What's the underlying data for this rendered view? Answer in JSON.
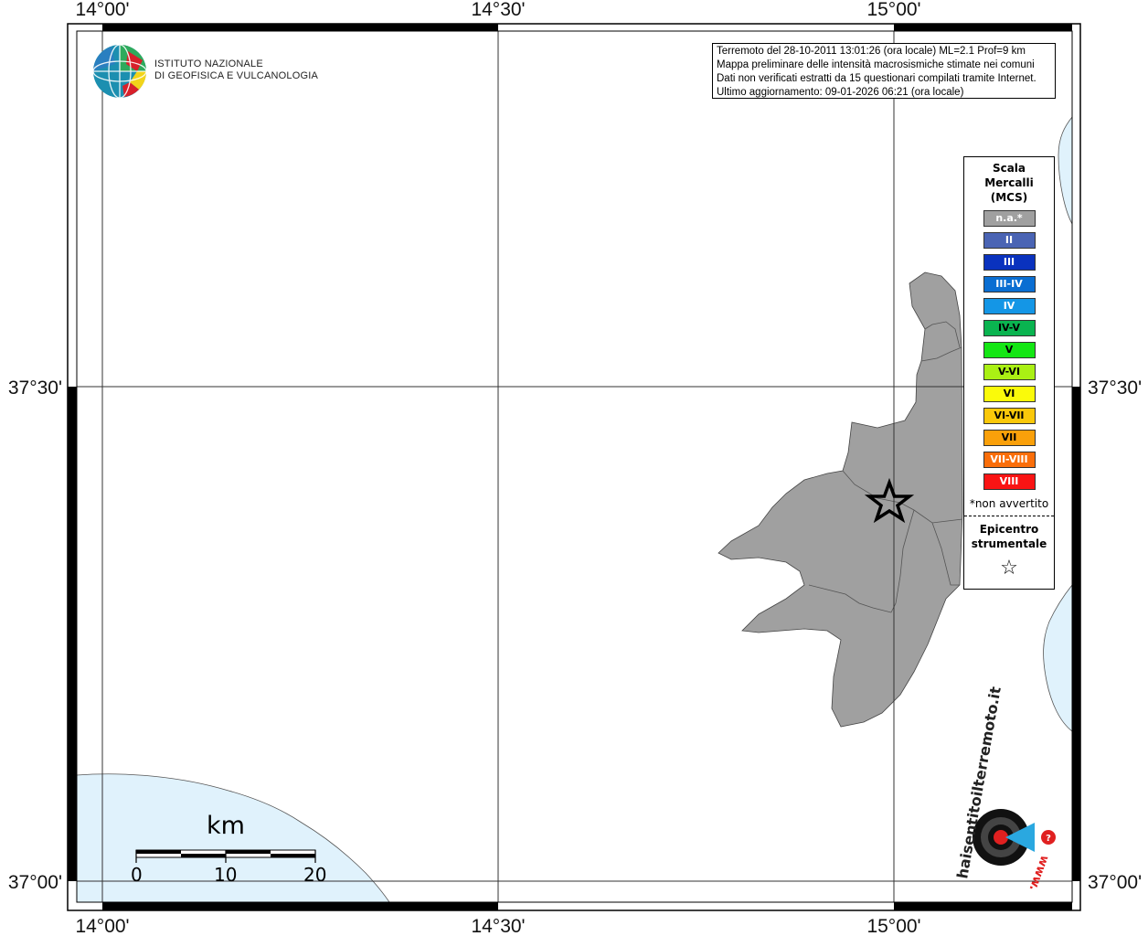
{
  "map": {
    "lon_ticks": [
      "14°00'",
      "14°30'",
      "15°00'"
    ],
    "lat_ticks": [
      "37°30'",
      "37°00'"
    ]
  },
  "institution": {
    "line1": "ISTITUTO NAZIONALE",
    "line2": "DI GEOFISICA E VULCANOLOGIA"
  },
  "info": {
    "lines": [
      "Terremoto del 28-10-2011 13:01:26 (ora locale) ML=2.1 Prof=9 km",
      "Mappa preliminare delle intensità macrosismiche stimate nei comuni",
      "Dati non verificati estratti da 15 questionari compilati tramite Internet.",
      "Ultimo aggiornamento: 09-01-2026 06:21 (ora locale)"
    ]
  },
  "legend": {
    "title": "Scala\nMercalli\n(MCS)",
    "items": [
      {
        "label": "n.a.*",
        "color": "#a0a0a0"
      },
      {
        "label": "II",
        "color": "#4a64b4"
      },
      {
        "label": "III",
        "color": "#0a32be"
      },
      {
        "label": "III-IV",
        "color": "#0a6ed2"
      },
      {
        "label": "IV",
        "color": "#1496e6"
      },
      {
        "label": "IV-V",
        "color": "#0ab450"
      },
      {
        "label": "V",
        "color": "#14e614"
      },
      {
        "label": "V-VI",
        "color": "#aaf014"
      },
      {
        "label": "VI",
        "color": "#fafa0a"
      },
      {
        "label": "VI-VII",
        "color": "#fac80a"
      },
      {
        "label": "VII",
        "color": "#faa00a"
      },
      {
        "label": "VII-VIII",
        "color": "#fa6e0a"
      },
      {
        "label": "VIII",
        "color": "#fa1414"
      }
    ],
    "note": "*non avvertito",
    "epicenter_label": "Epicentro\nstrumentale",
    "epicenter_symbol": "☆"
  },
  "scale_bar": {
    "unit": "km",
    "labels": [
      "0",
      "10",
      "20"
    ]
  },
  "site_logo": {
    "text": "haisentitoilterremoto.it",
    "url_text": "www."
  },
  "colors": {
    "land": "#a0a0a0",
    "sea": "#e0f2fc",
    "frame": "#000000"
  }
}
